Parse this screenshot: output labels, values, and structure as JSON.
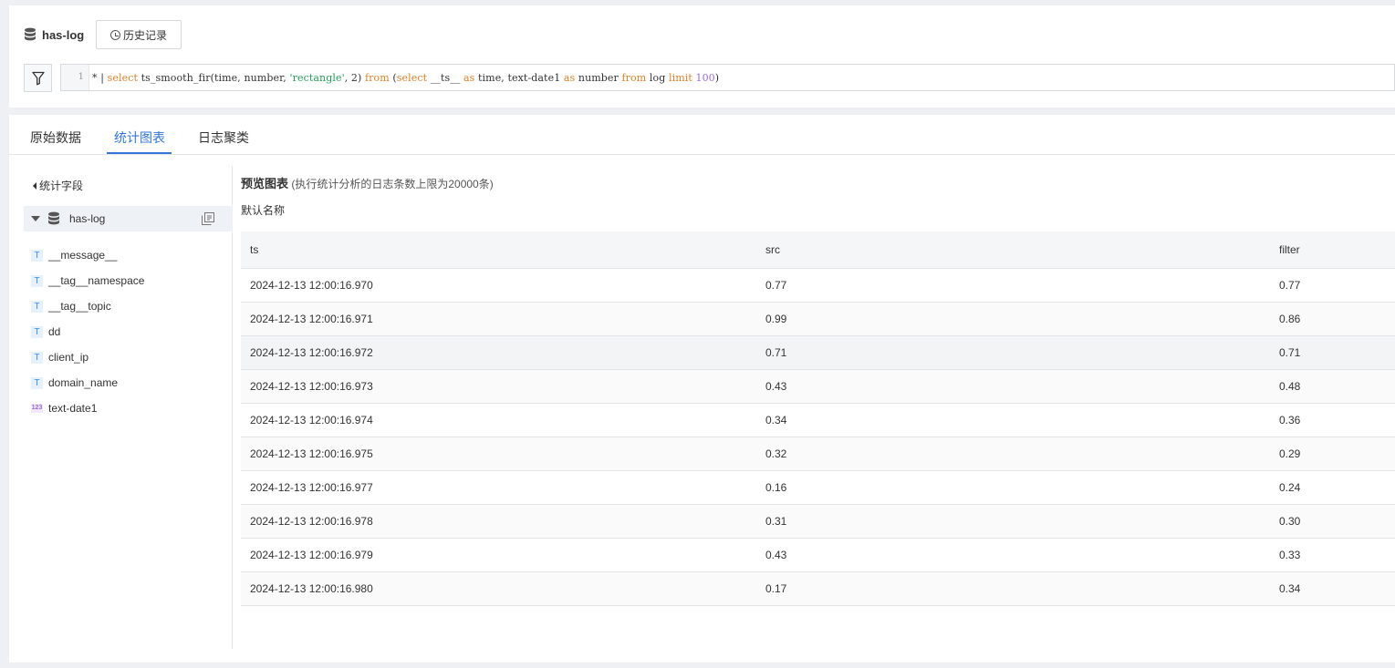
{
  "header": {
    "logstore_name": "has-log",
    "history_label": "历史记录"
  },
  "query": {
    "line_number": "1",
    "tokens": [
      {
        "text": "* | ",
        "cls": "plain"
      },
      {
        "text": "select",
        "cls": "kw"
      },
      {
        "text": " ts_smooth_fir(time, number, ",
        "cls": "plain"
      },
      {
        "text": "'rectangle'",
        "cls": "str"
      },
      {
        "text": ", 2) ",
        "cls": "plain"
      },
      {
        "text": "from",
        "cls": "kw"
      },
      {
        "text": " (",
        "cls": "plain"
      },
      {
        "text": "select",
        "cls": "kw"
      },
      {
        "text": " __ts__ ",
        "cls": "plain"
      },
      {
        "text": "as",
        "cls": "kw"
      },
      {
        "text": " time, text-date1 ",
        "cls": "plain"
      },
      {
        "text": "as",
        "cls": "kw"
      },
      {
        "text": " number ",
        "cls": "plain"
      },
      {
        "text": "from",
        "cls": "kw"
      },
      {
        "text": " log ",
        "cls": "plain"
      },
      {
        "text": "limit",
        "cls": "kw"
      },
      {
        "text": " 100",
        "cls": "num"
      },
      {
        "text": ")",
        "cls": "plain"
      }
    ]
  },
  "tabs": [
    {
      "label": "原始数据",
      "active": false
    },
    {
      "label": "统计图表",
      "active": true
    },
    {
      "label": "日志聚类",
      "active": false
    }
  ],
  "sidebar": {
    "back_label": "统计字段",
    "store_name": "has-log",
    "fields": [
      {
        "name": "__message__",
        "type": "text"
      },
      {
        "name": "__tag__namespace",
        "type": "text"
      },
      {
        "name": "__tag__topic",
        "type": "text"
      },
      {
        "name": "dd",
        "type": "text"
      },
      {
        "name": "client_ip",
        "type": "text"
      },
      {
        "name": "domain_name",
        "type": "text"
      },
      {
        "name": "text-date1",
        "type": "number"
      }
    ],
    "number_badge": "123",
    "text_badge": "T"
  },
  "preview": {
    "title": "预览图表",
    "note": "(执行统计分析的日志条数上限为20000条)",
    "chart_name": "默认名称"
  },
  "table": {
    "columns": [
      "ts",
      "src",
      "filter"
    ],
    "rows": [
      [
        "2024-12-13 12:00:16.970",
        "0.77",
        "0.77"
      ],
      [
        "2024-12-13 12:00:16.971",
        "0.99",
        "0.86"
      ],
      [
        "2024-12-13 12:00:16.972",
        "0.71",
        "0.71"
      ],
      [
        "2024-12-13 12:00:16.973",
        "0.43",
        "0.48"
      ],
      [
        "2024-12-13 12:00:16.974",
        "0.34",
        "0.36"
      ],
      [
        "2024-12-13 12:00:16.975",
        "0.32",
        "0.29"
      ],
      [
        "2024-12-13 12:00:16.977",
        "0.16",
        "0.24"
      ],
      [
        "2024-12-13 12:00:16.978",
        "0.31",
        "0.30"
      ],
      [
        "2024-12-13 12:00:16.979",
        "0.43",
        "0.33"
      ],
      [
        "2024-12-13 12:00:16.980",
        "0.17",
        "0.34"
      ]
    ]
  },
  "colors": {
    "accent": "#3476d6",
    "keyword": "#d9822b",
    "string": "#2a9d5a",
    "number": "#9a6dd7"
  }
}
